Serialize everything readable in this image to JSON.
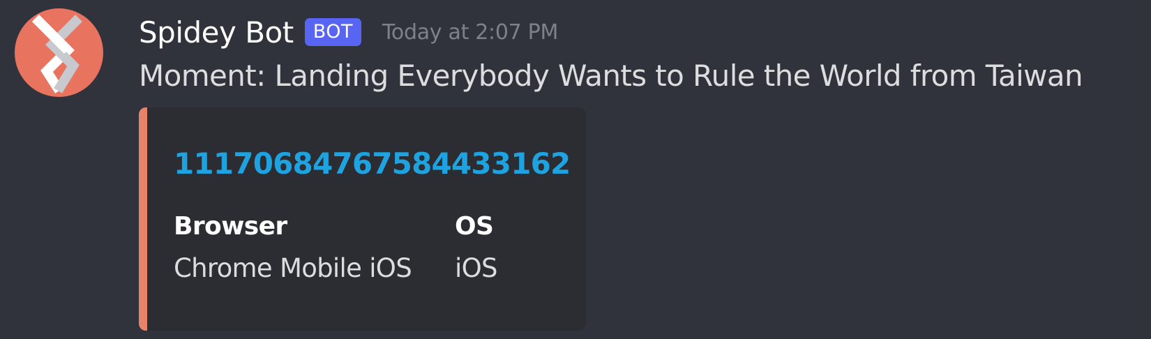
{
  "message": {
    "avatar": {
      "icon": "bot-logo-icon",
      "background_color": "#e8735f"
    },
    "author": {
      "username": "Spidey Bot",
      "tag": "BOT",
      "tag_color": "#5865f2"
    },
    "timestamp": "Today at 2:07 PM",
    "content": "Moment: Landing Everybody Wants to Rule the World from Taiwan",
    "embed": {
      "accent_color": "#e8836b",
      "title": "1117068476758443316​2",
      "fields": [
        {
          "name": "Browser",
          "value": "Chrome Mobile iOS"
        },
        {
          "name": "OS",
          "value": "iOS"
        }
      ]
    }
  }
}
